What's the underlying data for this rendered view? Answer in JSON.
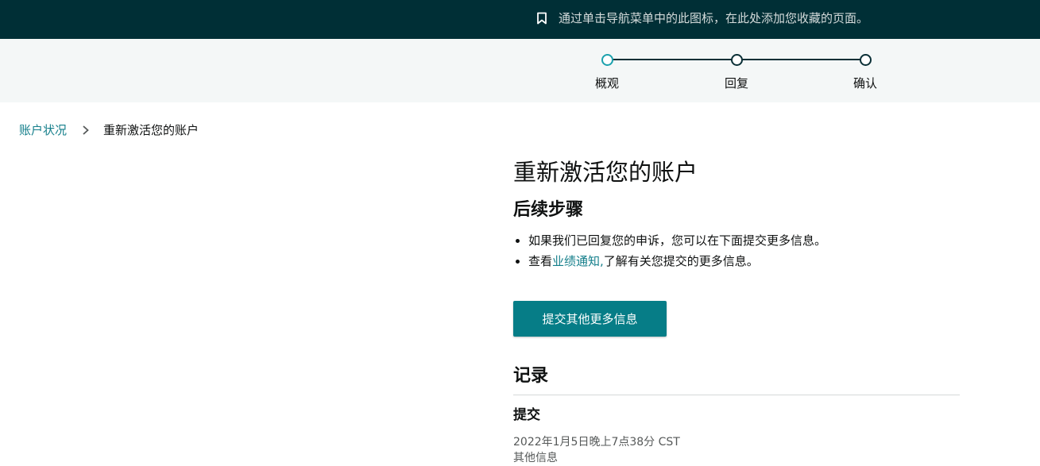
{
  "topbar": {
    "icon": "bookmark-icon",
    "message": "通过单击导航菜单中的此图标，在此处添加您收藏的页面。"
  },
  "stepper": {
    "steps": [
      {
        "label": "概观",
        "active": true
      },
      {
        "label": "回复",
        "active": false
      },
      {
        "label": "确认",
        "active": false
      }
    ]
  },
  "breadcrumb": {
    "parent": "账户状况",
    "separator_icon": "chevron-right-icon",
    "current": "重新激活您的账户"
  },
  "main": {
    "title": "重新激活您的账户",
    "next_steps_title": "后续步骤",
    "step1": "如果我们已回复您的申诉，您可以在下面提交更多信息。",
    "step2_prefix": "查看",
    "step2_link": "业绩通知,",
    "step2_suffix": "了解有关您提交的更多信息。",
    "submit_button": "提交其他更多信息"
  },
  "history": {
    "title": "记录",
    "entry_title": "提交",
    "entry_time": "2022年1月5日晚上7点38分 CST",
    "entry_detail": "其他信息"
  },
  "colors": {
    "topbar_bg": "#002f36",
    "accent": "#067d87",
    "link": "#137e8a",
    "active_step": "#1ba1ad"
  }
}
